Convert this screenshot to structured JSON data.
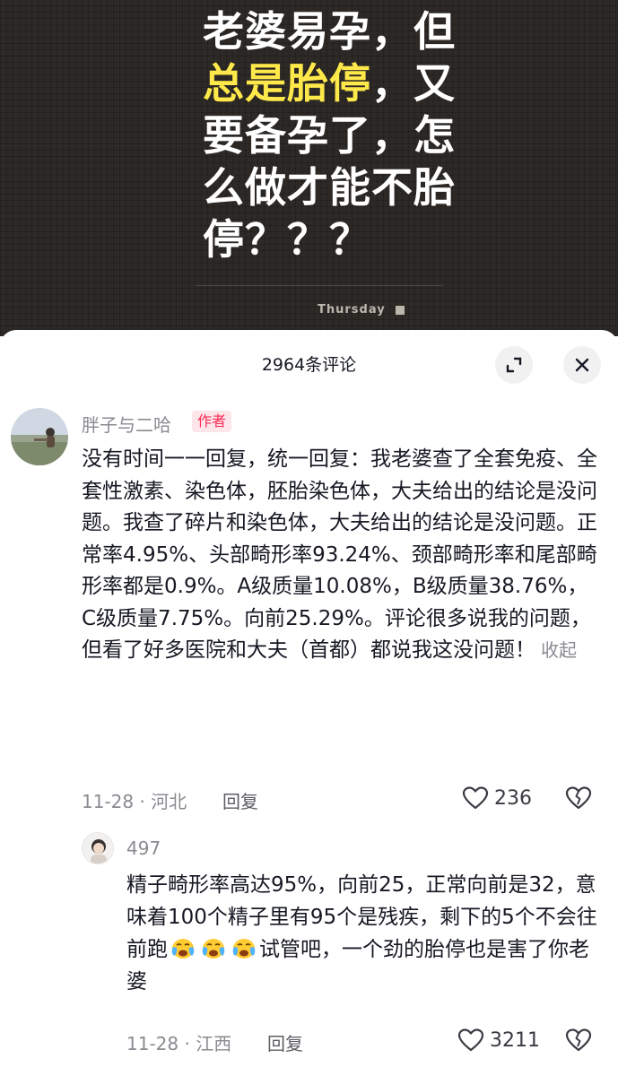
{
  "video": {
    "lines": [
      {
        "pre": "老婆易孕，但",
        "hl": "",
        "post": ""
      },
      {
        "pre": "",
        "hl": "总是胎停",
        "post": "，又"
      },
      {
        "pre": "要备孕了，怎",
        "hl": "",
        "post": ""
      },
      {
        "pre": "么做才能不胎",
        "hl": "",
        "post": ""
      },
      {
        "pre": "停？？？",
        "hl": "",
        "post": ""
      }
    ],
    "brand": "Thursday",
    "highlight_color": "#ffe94a"
  },
  "sheet": {
    "title": "2964条评论",
    "expand_icon": "expand-icon",
    "close_icon": "close-icon"
  },
  "comment": {
    "username": "胖子与二哈",
    "author_tag": "作者",
    "text": "没有时间一一回复，统一回复：我老婆查了全套免疫、全套性激素、染色体，胚胎染色体，大夫给出的结论是没问题。我查了碎片和染色体，大夫给出的结论是没问题。正常率4.95%、头部畸形率93.24%、颈部畸形率和尾部畸形率都是0.9%。A级质量10.08%，B级质量38.76%，C级质量7.75%。向前25.29%。评论很多说我的问题，但看了好多医院和大夫（首都）都说我这没问题！",
    "collapse": "收起",
    "date": "11-28",
    "location": "河北",
    "reply_label": "回复",
    "likes": "236"
  },
  "reply": {
    "username": "497",
    "text_before": "精子畸形率高达95%，向前25，正常向前是32，意味着100个精子里有95个是残疾，剩下的5个不会往前跑",
    "emoji_count": 3,
    "text_after": "试管吧，一个劲的胎停也是害了你老婆",
    "date": "11-28",
    "location": "江西",
    "reply_label": "回复",
    "likes": "3211"
  },
  "colors": {
    "author_tag": "#fe2c55",
    "video_bg": "#2d2926"
  }
}
